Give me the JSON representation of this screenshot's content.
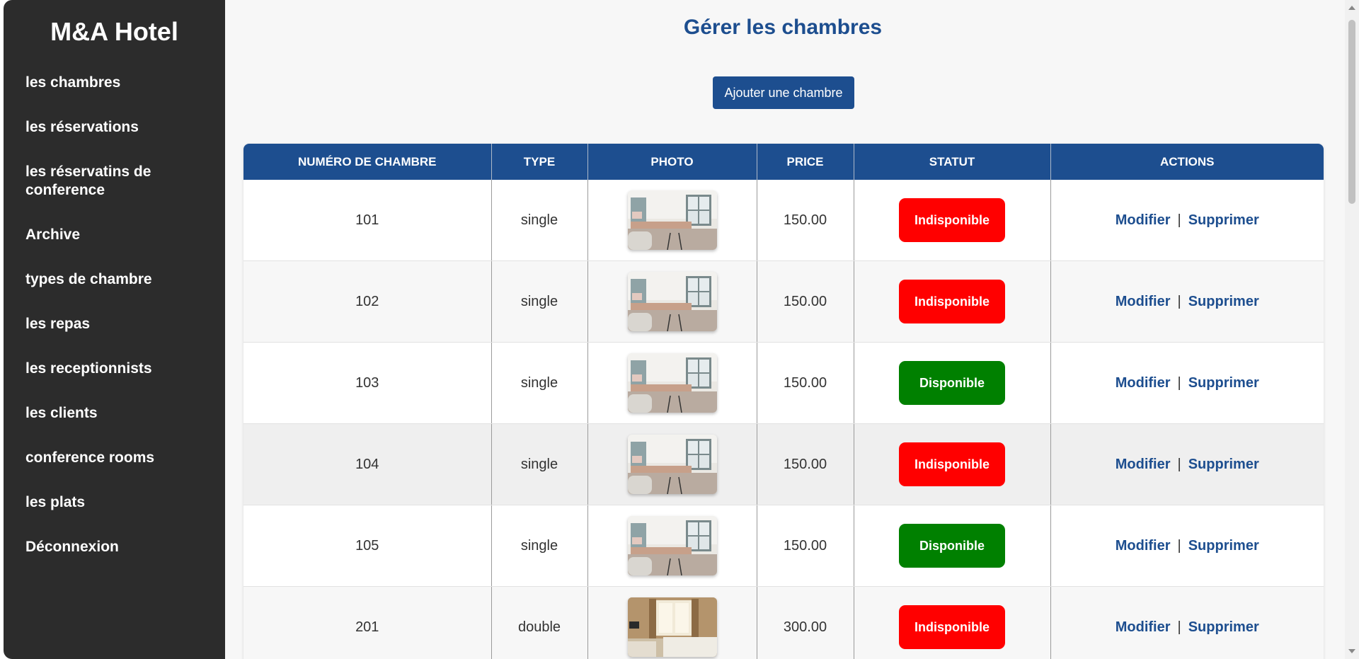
{
  "sidebar": {
    "brand": "M&A Hotel",
    "items": [
      {
        "label": "les chambres"
      },
      {
        "label": "les réservations"
      },
      {
        "label": "les réservatins de conference"
      },
      {
        "label": "Archive"
      },
      {
        "label": "types de chambre"
      },
      {
        "label": "les repas"
      },
      {
        "label": "les receptionnists"
      },
      {
        "label": "les clients"
      },
      {
        "label": "conference rooms"
      },
      {
        "label": "les plats"
      },
      {
        "label": "Déconnexion"
      }
    ]
  },
  "main": {
    "title": "Gérer les chambres",
    "add_button": "Ajouter une chambre",
    "table": {
      "headers": [
        "NUMÉRO DE CHAMBRE",
        "TYPE",
        "PHOTO",
        "PRICE",
        "STATUT",
        "ACTIONS"
      ],
      "rows": [
        {
          "number": "101",
          "type": "single",
          "photo": "room-photo-single",
          "price": "150.00",
          "status": "Indisponible",
          "modify": "Modifier",
          "sep": "|",
          "delete": "Supprimer"
        },
        {
          "number": "102",
          "type": "single",
          "photo": "room-photo-single",
          "price": "150.00",
          "status": "Indisponible",
          "modify": "Modifier",
          "sep": "|",
          "delete": "Supprimer"
        },
        {
          "number": "103",
          "type": "single",
          "photo": "room-photo-single",
          "price": "150.00",
          "status": "Disponible",
          "modify": "Modifier",
          "sep": "|",
          "delete": "Supprimer"
        },
        {
          "number": "104",
          "type": "single",
          "photo": "room-photo-single",
          "price": "150.00",
          "status": "Indisponible",
          "modify": "Modifier",
          "sep": "|",
          "delete": "Supprimer"
        },
        {
          "number": "105",
          "type": "single",
          "photo": "room-photo-single",
          "price": "150.00",
          "status": "Disponible",
          "modify": "Modifier",
          "sep": "|",
          "delete": "Supprimer"
        },
        {
          "number": "201",
          "type": "double",
          "photo": "room-photo-double",
          "price": "300.00",
          "status": "Indisponible",
          "modify": "Modifier",
          "sep": "|",
          "delete": "Supprimer"
        }
      ]
    }
  },
  "colors": {
    "sidebar_bg": "#2c2c2c",
    "accent": "#1d4e8f",
    "status_unavailable": "#ff0000",
    "status_available": "#008000"
  }
}
